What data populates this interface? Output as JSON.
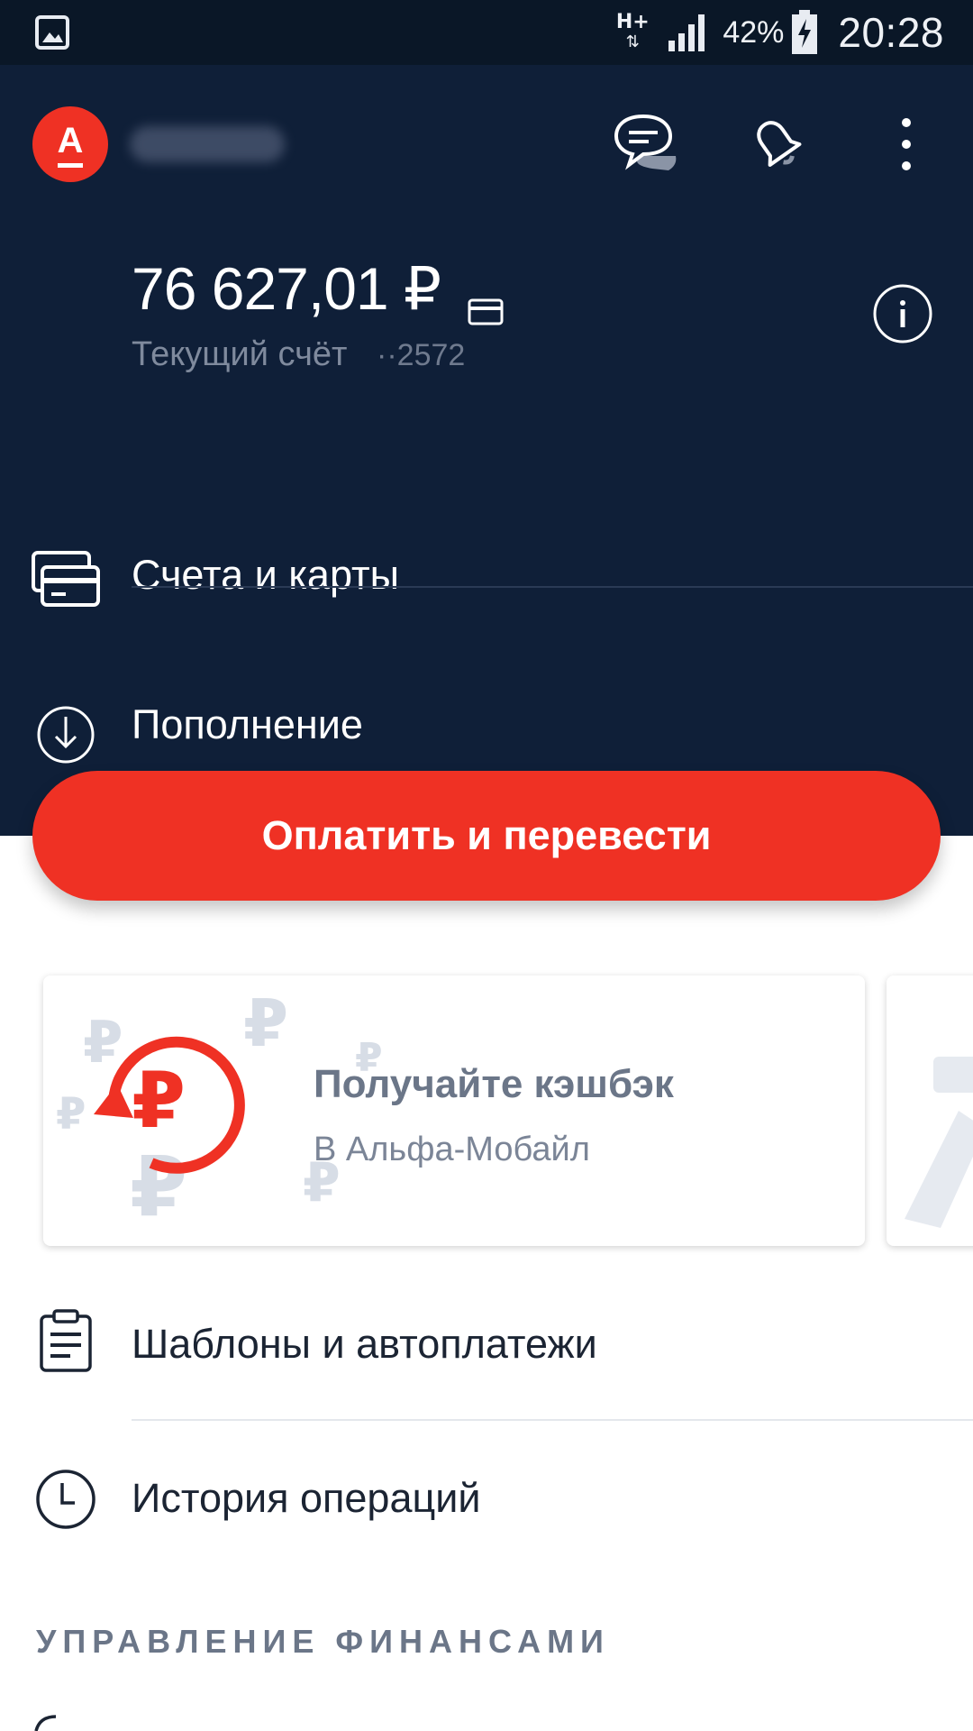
{
  "status_bar": {
    "network": "H+",
    "battery_percent": "42%",
    "time": "20:28",
    "icons": [
      "gallery-icon",
      "signal-icon",
      "battery-icon"
    ]
  },
  "header": {
    "logo_letter": "А",
    "balance": "76 627,01 ₽",
    "account_name": "Текущий счёт",
    "account_number": "··2572",
    "menu": [
      {
        "label": "Счета и карты",
        "icon": "cards-icon"
      },
      {
        "label": "Пополнение",
        "icon": "download-circle-icon"
      }
    ]
  },
  "actions": {
    "pay_label": "Оплатить и перевести"
  },
  "promo": {
    "title": "Получайте кэшбэк",
    "subtitle": "В Альфа-Мобайл",
    "icon": "cashback-ruble-icon"
  },
  "list": [
    {
      "label": "Шаблоны и автоплатежи",
      "icon": "clipboard-icon"
    },
    {
      "label": "История операций",
      "icon": "clock-icon"
    }
  ],
  "section": {
    "title": "УПРАВЛЕНИЕ ФИНАНСАМИ"
  },
  "colors": {
    "header_bg": "#0f1f38",
    "status_bg": "#0a1727",
    "accent": "#ef3124"
  }
}
